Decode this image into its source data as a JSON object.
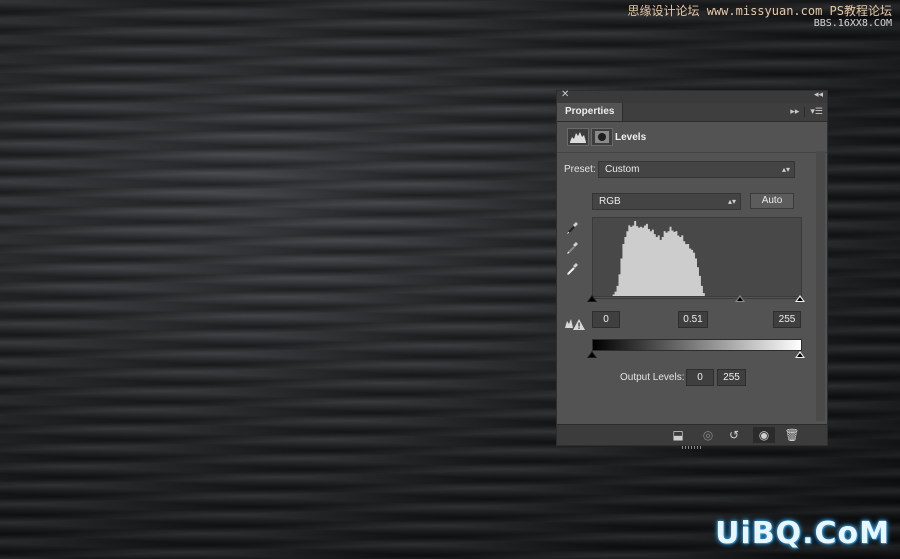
{
  "watermark": {
    "line1": "思缘设计论坛 www.missyuan.com  PS教程论坛",
    "line2": "BBS.16XX8.COM",
    "bottom": "UiBQ.CoM"
  },
  "panel": {
    "close_icon": "close-icon",
    "collapse_icon": "collapse-icon",
    "tab_label": "Properties",
    "adjustment_title": "Levels",
    "preset_label": "Preset:",
    "preset_value": "Custom",
    "channel_value": "RGB",
    "auto_label": "Auto",
    "input_black": "0",
    "input_gamma": "0.51",
    "input_white": "255",
    "output_label": "Output Levels:",
    "output_black": "0",
    "output_white": "255",
    "input_slider_fractions": {
      "black": 0.0,
      "gamma": 0.71,
      "white": 1.0
    },
    "output_slider_fractions": {
      "black": 0.0,
      "white": 1.0
    },
    "histogram": [
      0,
      0,
      0,
      0,
      0,
      0,
      0,
      0,
      0,
      0,
      2,
      6,
      14,
      30,
      52,
      68,
      82,
      90,
      94,
      96,
      98,
      100,
      97,
      95,
      92,
      95,
      98,
      96,
      93,
      90,
      88,
      86,
      82,
      80,
      78,
      82,
      86,
      88,
      90,
      92,
      91,
      89,
      86,
      84,
      82,
      80,
      76,
      72,
      68,
      66,
      64,
      60,
      52,
      40,
      28,
      14,
      4,
      0,
      0,
      0,
      0,
      0,
      0,
      0,
      0,
      0,
      0,
      0,
      0,
      0,
      0,
      0,
      0,
      0,
      0,
      0,
      0,
      0,
      0,
      0,
      0,
      0,
      0,
      0,
      0,
      0,
      0,
      0,
      0,
      0,
      0,
      0,
      0,
      0,
      0,
      0,
      0,
      0,
      0,
      0,
      0,
      0,
      0,
      0,
      0,
      0
    ],
    "colors": {
      "panel_bg": "#535353",
      "histogram_fill": "#cdcdcd"
    }
  }
}
